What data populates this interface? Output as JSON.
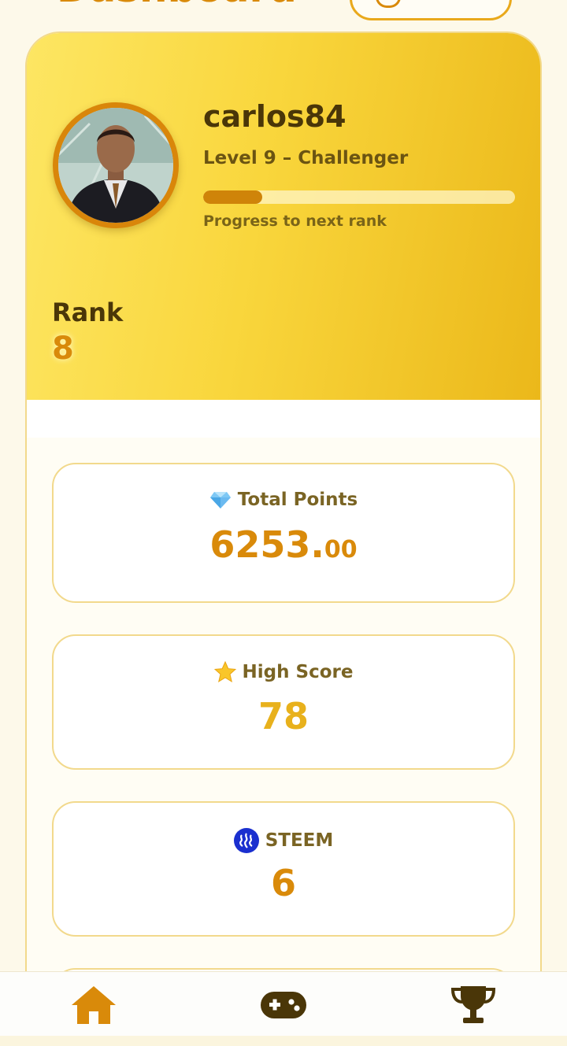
{
  "header": {
    "title": "Dashboard"
  },
  "profile": {
    "username": "carlos84",
    "level_text": "Level 9 – Challenger",
    "progress_fraction": 0.19,
    "progress_label": "Progress to next rank",
    "rank_label": "Rank",
    "rank_value": "8"
  },
  "stats": {
    "total_points": {
      "label": "Total Points",
      "value_int": "6253.",
      "value_dec": "00",
      "icon": "gem-icon"
    },
    "high_score": {
      "label": "High Score",
      "value": "78",
      "icon": "star-icon"
    },
    "steem": {
      "label": "STEEM",
      "value": "6",
      "icon": "steem-icon"
    }
  },
  "nav": {
    "items": [
      "home-icon",
      "gamepad-icon",
      "trophy-icon"
    ]
  },
  "colors": {
    "accent": "#d98a0a",
    "gold": "#e8b11c",
    "dark_text": "#4a3608",
    "background": "#fdf9ea"
  }
}
